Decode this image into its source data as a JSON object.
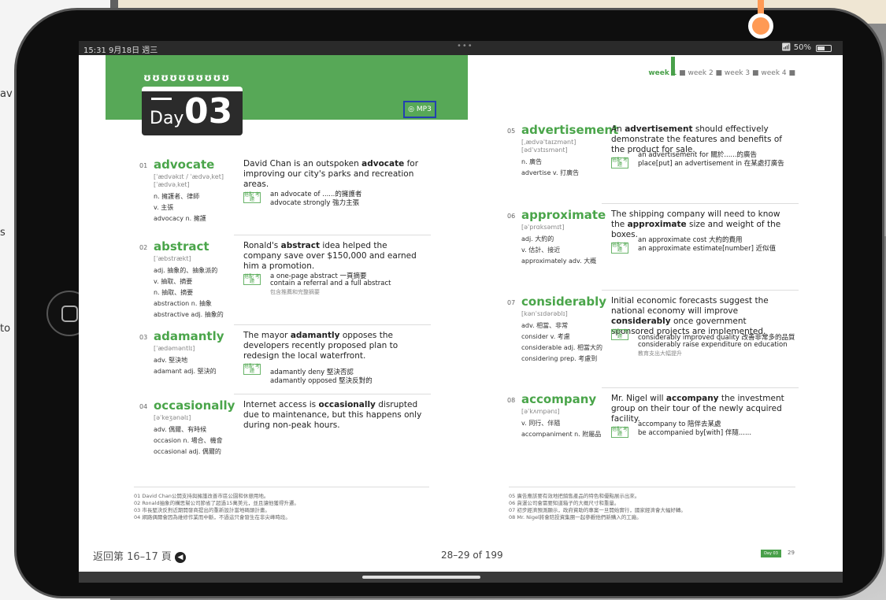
{
  "status_bar": {
    "time": "15:31 9月18日 週三",
    "dots": "•••",
    "battery": "50%"
  },
  "header": {
    "day_word": "Day",
    "day_number": "03",
    "mp3": "MP3"
  },
  "week_nav": {
    "w1": "week 1",
    "w2": "week 2",
    "w3": "week 3",
    "w4": "week 4"
  },
  "entries": [
    {
      "no": "01",
      "word": "advocate",
      "phon1": "[ˈædvəkɪt / ˈædvəˌket]",
      "phon2": "[ˈædvəˌket]",
      "m1": "n. 擁護者、律師",
      "m2": "v. 主張",
      "m3": "advocacy n. 擁護",
      "sentence_pre": "David Chan is an outspoken ",
      "sentence_bold": "advocate",
      "sentence_post": " for improving our city's parks and recreation areas.",
      "c1": "an advocate of ......的擁護者",
      "c2": "advocate strongly 強力主張"
    },
    {
      "no": "02",
      "word": "abstract",
      "phon1": "[ˈæbstrækt]",
      "m1": "adj. 抽象的、抽象派的",
      "m2": "v. 抽取、摘要",
      "m3": "n. 抽取、摘要",
      "m4": "abstraction n. 抽象",
      "m5": "abstractive adj. 抽象的",
      "sentence_pre": "Ronald's ",
      "sentence_bold": "abstract",
      "sentence_post": " idea helped the company save over $150,000 and earned him a promotion.",
      "c1": "a one-page abstract 一頁摘要",
      "c2": "contain a referral and a full abstract",
      "c3": "包含推薦和完整摘要"
    },
    {
      "no": "03",
      "word": "adamantly",
      "phon1": "[ˈædəməntlɪ]",
      "m1": "adv. 堅決地",
      "m2": "adamant adj. 堅決的",
      "sentence_pre": "The mayor ",
      "sentence_bold": "adamantly",
      "sentence_post": " opposes the developers recently proposed plan to redesign the local waterfront.",
      "c1": "adamantly deny 堅決否認",
      "c2": "adamantly opposed 堅決反對的"
    },
    {
      "no": "04",
      "word": "occasionally",
      "phon1": "[əˈkeʒənəlɪ]",
      "m1": "adv. 偶爾、有時候",
      "m2": "occasion n. 場合、機會",
      "m3": "occasional adj. 偶爾的",
      "sentence_pre": "Internet access is ",
      "sentence_bold": "occasionally",
      "sentence_post": " disrupted due to maintenance, but this happens only during non-peak hours."
    },
    {
      "no": "05",
      "word": "advertisement",
      "phon1": "[ˌædvəˈtaɪzmənt]",
      "phon2": "[ədˈvɜtɪsmənt]",
      "m1": "n. 廣告",
      "m2": "advertise v. 打廣告",
      "sentence_pre": "An ",
      "sentence_bold": "advertisement",
      "sentence_post": " should effectively demonstrate the features and benefits of the product for sale.",
      "c1": "an advertisement for 關於......的廣告",
      "c2": "place[put] an advertisement in 在某處打廣告"
    },
    {
      "no": "06",
      "word": "approximate",
      "phon1": "[əˈprɑksəmɪt]",
      "m1": "adj. 大約的",
      "m2": "v. 估計、接近",
      "m3": "approximately adv. 大概",
      "sentence_pre": "The shipping company will need to know the ",
      "sentence_bold": "approximate",
      "sentence_post": " size and weight of the boxes.",
      "c1": "an approximate cost 大約的費用",
      "c2": "an approximate estimate[number] 近似值"
    },
    {
      "no": "07",
      "word": "considerably",
      "phon1": "[kənˈsɪdərəblɪ]",
      "m1": "adv. 相當、非常",
      "m2": "consider v. 考慮",
      "m3": "considerable adj. 相當大的",
      "m4": "considering prep. 考慮到",
      "sentence_pre": "Initial economic forecasts suggest the national economy will improve ",
      "sentence_bold": "considerably",
      "sentence_post": " once government sponsored projects are implemented.",
      "c1": "considerably improved quality 改善非常多的品質",
      "c2": "considerably raise expenditure on education",
      "c3": "教育支出大幅提升"
    },
    {
      "no": "08",
      "word": "accompany",
      "phon1": "[əˈkʌmpənɪ]",
      "m1": "v. 同行、伴隨",
      "m2": "accompaniment n. 附屬品",
      "sentence_pre": "Mr. Nigel will ",
      "sentence_bold": "accompany",
      "sentence_post": " the investment group on their tour of the newly acquired facility.",
      "c1": "accompany to 陪伴去某處",
      "c2": "be accompanied by[with] 伴隨......"
    }
  ],
  "tag_label": "搭配\n考題",
  "notes_left": [
    "01 David Chan公開支持與擁護改善市區公園和休憩用地。",
    "02 Ronald抽象的構思幫公司節省了超過15萬美元，並且讓他獲得升遷。",
    "03 市長堅決反對近期開發商提出的重新設計當地碼頭計畫。",
    "04 網路偶爾會因為維修作業而中斷，不過這只會發生在非尖峰時段。"
  ],
  "notes_right": [
    "05 廣告應該要有效地把銷售產品的特色和優點展示出來。",
    "06 貨運公司會需要知道箱子的大概尺寸和重量。",
    "07 初步經濟預測顯示，政府資助的專案一旦開始實行，國家經濟會大幅好轉。",
    "08 Mr. Nigel將會陪投資集團一起參觀他們新購入的工廠。"
  ],
  "footer": {
    "back": "返回第 16–17 頁",
    "page": "28–29 of 199",
    "day_tag": "Day 03",
    "small_page": "29"
  }
}
